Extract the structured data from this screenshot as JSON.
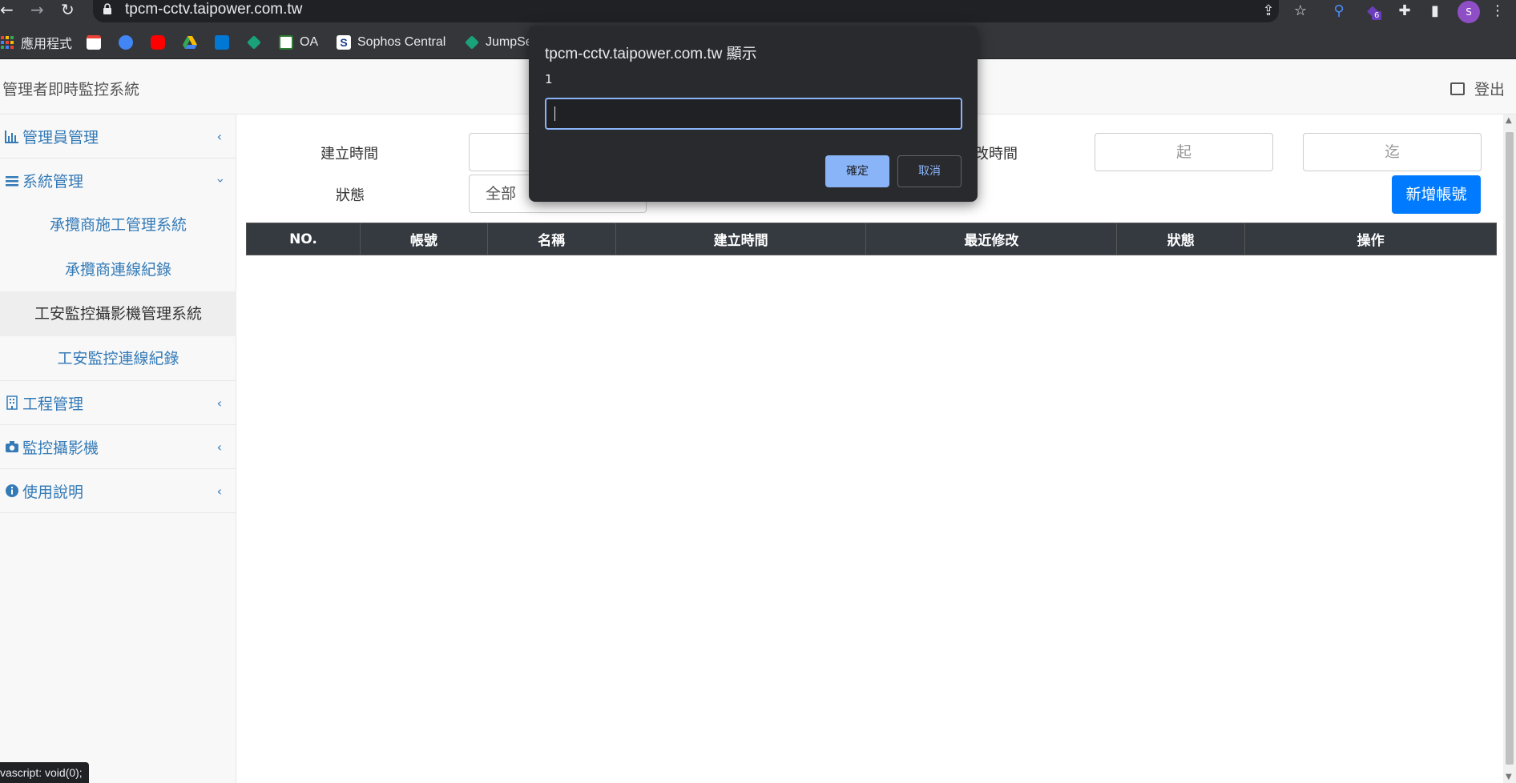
{
  "browser": {
    "url": "tpcm-cctv.taipower.com.tw",
    "status_text": "vascript: void(0);",
    "profile_initial": "S",
    "extension_badge": "6",
    "bookmarks": [
      {
        "label": "應用程式",
        "icon": "apps-grid-icon",
        "color": "#ea4335"
      },
      {
        "label": "",
        "icon": "gmail-icon",
        "color": "#ea4335"
      },
      {
        "label": "",
        "icon": "globe-icon",
        "color": "#4285f4"
      },
      {
        "label": "",
        "icon": "youtube-icon",
        "color": "#ff0000"
      },
      {
        "label": "",
        "icon": "drive-icon",
        "color": "#34a853"
      },
      {
        "label": "",
        "icon": "outlook-icon",
        "color": "#0078d4"
      },
      {
        "label": "",
        "icon": "layers-icon",
        "color": "#1aa37a"
      },
      {
        "label": "OA",
        "icon": "oa-icon",
        "color": "#2e7d32"
      },
      {
        "label": "Sophos Central",
        "icon": "sophos-icon",
        "color": "#ffffff"
      },
      {
        "label": "JumpSe",
        "icon": "jumpserver-icon",
        "color": "#1aa37a"
      }
    ]
  },
  "header": {
    "brand": "管理者即時監控系統",
    "logout": "登出"
  },
  "sidebar": {
    "items": [
      {
        "label": "管理員管理",
        "icon": "bar-chart-icon",
        "chevron": "‹"
      },
      {
        "label": "系統管理",
        "icon": "list-icon",
        "chevron": "‹"
      },
      {
        "label": "工程管理",
        "icon": "building-icon",
        "chevron": "‹"
      },
      {
        "label": "監控攝影機",
        "icon": "camera-icon",
        "chevron": "‹"
      },
      {
        "label": "使用說明",
        "icon": "info-icon",
        "chevron": "‹"
      }
    ],
    "sub_items": [
      {
        "label": "承攬商施工管理系統"
      },
      {
        "label": "承攬商連線紀錄"
      },
      {
        "label": "工安監控攝影機管理系統"
      },
      {
        "label": "工安監控連線紀錄"
      }
    ]
  },
  "filters": {
    "created_label": "建立時間",
    "modified_label": "改時間",
    "status_label": "狀態",
    "status_value": "全部",
    "from_placeholder": "起",
    "to_placeholder": "迄",
    "add_button": "新增帳號"
  },
  "table": {
    "columns": [
      "NO.",
      "帳號",
      "名稱",
      "建立時間",
      "最近修改",
      "狀態",
      "操作"
    ]
  },
  "dialog": {
    "title": "tpcm-cctv.taipower.com.tw 顯示",
    "message": "1",
    "input_value": "",
    "ok": "確定",
    "cancel": "取消"
  }
}
